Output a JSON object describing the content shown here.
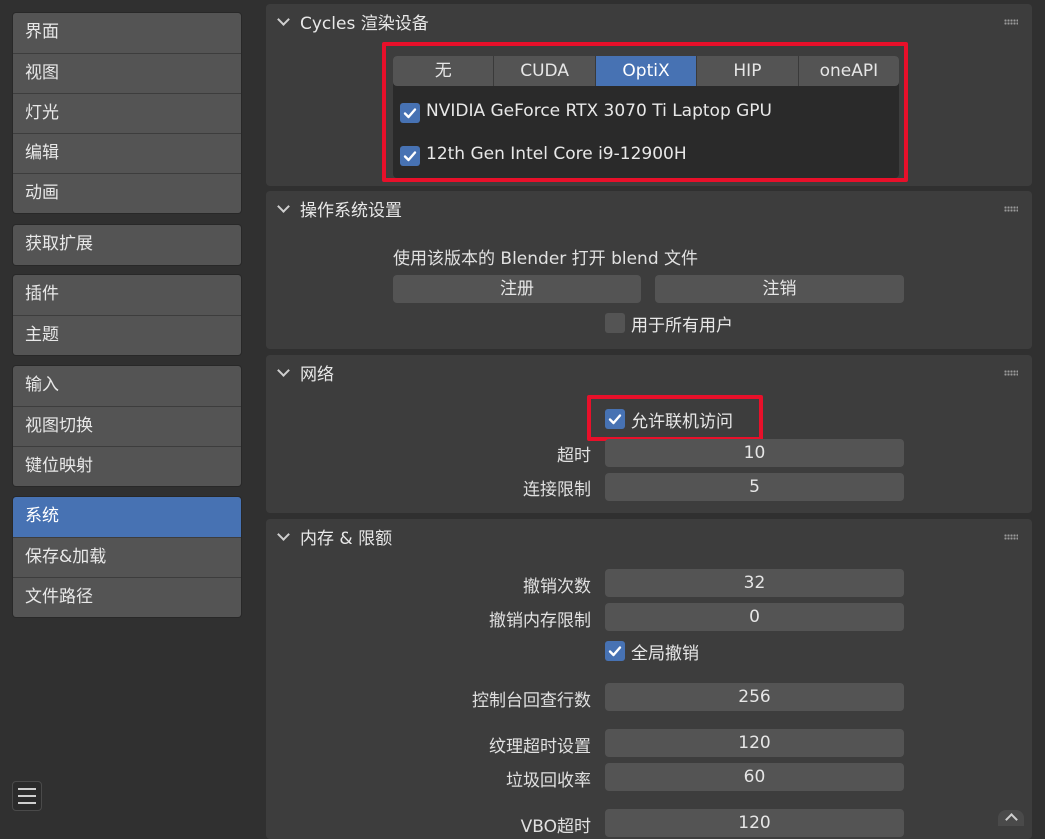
{
  "sidebar": {
    "groups": [
      [
        "界面",
        "视图",
        "灯光",
        "编辑",
        "动画"
      ],
      [
        "获取扩展"
      ],
      [
        "插件",
        "主题"
      ],
      [
        "输入",
        "视图切换",
        "键位映射"
      ],
      [
        "系统",
        "保存&加载",
        "文件路径"
      ]
    ],
    "active": "系统"
  },
  "cycles": {
    "title": "Cycles 渲染设备",
    "tabs": [
      "无",
      "CUDA",
      "OptiX",
      "HIP",
      "oneAPI"
    ],
    "active_tab": "OptiX",
    "devices": [
      {
        "name": "NVIDIA GeForce RTX 3070 Ti Laptop GPU",
        "checked": true
      },
      {
        "name": "12th Gen Intel Core i9-12900H",
        "checked": true
      }
    ]
  },
  "os": {
    "title": "操作系统设置",
    "desc": "使用该版本的 Blender 打开 blend 文件",
    "register": "注册",
    "unregister": "注销",
    "all_users": "用于所有用户",
    "all_users_checked": false
  },
  "network": {
    "title": "网络",
    "allow_online": "允许联机访问",
    "allow_online_checked": true,
    "timeout_label": "超时",
    "timeout_value": "10",
    "conn_limit_label": "连接限制",
    "conn_limit_value": "5"
  },
  "memory": {
    "title": "内存 & 限额",
    "undo_steps_label": "撤销次数",
    "undo_steps_value": "32",
    "undo_mem_label": "撤销内存限制",
    "undo_mem_value": "0",
    "global_undo": "全局撤销",
    "global_undo_checked": true,
    "console_label": "控制台回查行数",
    "console_value": "256",
    "tex_timeout_label": "纹理超时设置",
    "tex_timeout_value": "120",
    "gc_label": "垃圾回收率",
    "gc_value": "60",
    "vbo_label": "VBO超时",
    "vbo_value": "120"
  },
  "icons": {
    "checkbox": "checkmark-icon",
    "collapse": "chevron-down-icon",
    "grip": "drag-grip-icon",
    "menu": "hamburger-menu-icon"
  },
  "colors": {
    "accent": "#4772b3",
    "highlight": "#e8102a"
  }
}
